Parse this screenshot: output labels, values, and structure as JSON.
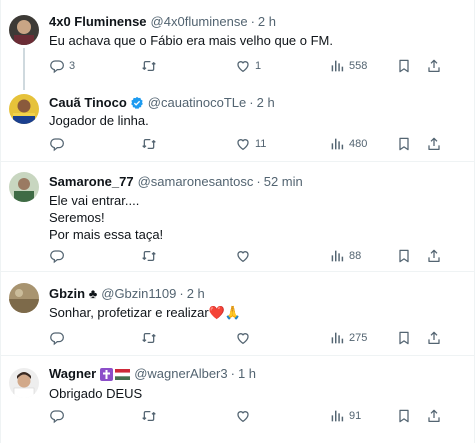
{
  "tweets": [
    {
      "name": "4x0 Fluminense",
      "handle": "@4x0fluminense",
      "time": "2 h",
      "text": "Eu achava que o Fábio era mais velho que o FM.",
      "replies": "3",
      "retweets": "",
      "likes": "1",
      "views": "558"
    },
    {
      "name": "Cauã Tinoco",
      "handle": "@cauatinocoTLe",
      "time": "2 h",
      "verified": true,
      "text": "Jogador de linha.",
      "replies": "",
      "retweets": "",
      "likes": "11",
      "views": "480"
    },
    {
      "name": "Samarone_77",
      "handle": "@samaronesantosc",
      "time": "52 min",
      "text": "Ele vai entrar....\nSeremos!\nPor mais essa taça!",
      "replies": "",
      "retweets": "",
      "likes": "",
      "views": "88"
    },
    {
      "name": "Gbzin ♣",
      "handle": "@Gbzin1109",
      "time": "2 h",
      "text": "Sonhar, profetizar e realizar❤️🙏",
      "replies": "",
      "retweets": "",
      "likes": "",
      "views": "275"
    },
    {
      "name": "Wagner",
      "handle": "@wagnerAlber3",
      "time": "1 h",
      "text": "Obrigado DEUS",
      "replies": "",
      "retweets": "",
      "likes": "",
      "views": "91"
    }
  ],
  "icons": {
    "reply": "reply-icon",
    "retweet": "retweet-icon",
    "like": "heart-icon",
    "views": "views-icon",
    "bookmark": "bookmark-icon",
    "share": "share-icon",
    "verified": "verified-badge-icon",
    "cross": "cross-emoji",
    "flag": "hungary-flag-icon"
  },
  "colors": {
    "text": "#0f1419",
    "secondary": "#536471",
    "border": "#eff3f4",
    "verified": "#1d9bf0",
    "heart": "#f91880"
  }
}
